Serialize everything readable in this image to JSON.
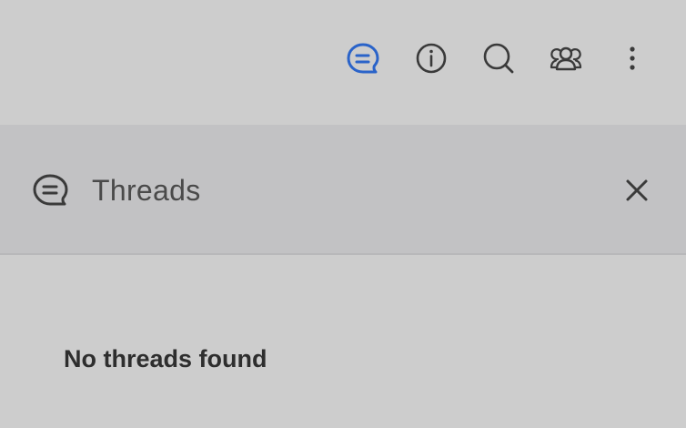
{
  "toolbar": {
    "icons": [
      {
        "name": "threads-icon",
        "active": true
      },
      {
        "name": "info-icon",
        "active": false
      },
      {
        "name": "search-icon",
        "active": false
      },
      {
        "name": "members-icon",
        "active": false
      },
      {
        "name": "more-vertical-icon",
        "active": false
      }
    ],
    "accent_color": "#2a63c9",
    "icon_color": "#3a3a3a"
  },
  "panel": {
    "title": "Threads",
    "header_icon": "threads-icon",
    "close_icon": "close-icon"
  },
  "main": {
    "empty_message": "No threads found"
  }
}
